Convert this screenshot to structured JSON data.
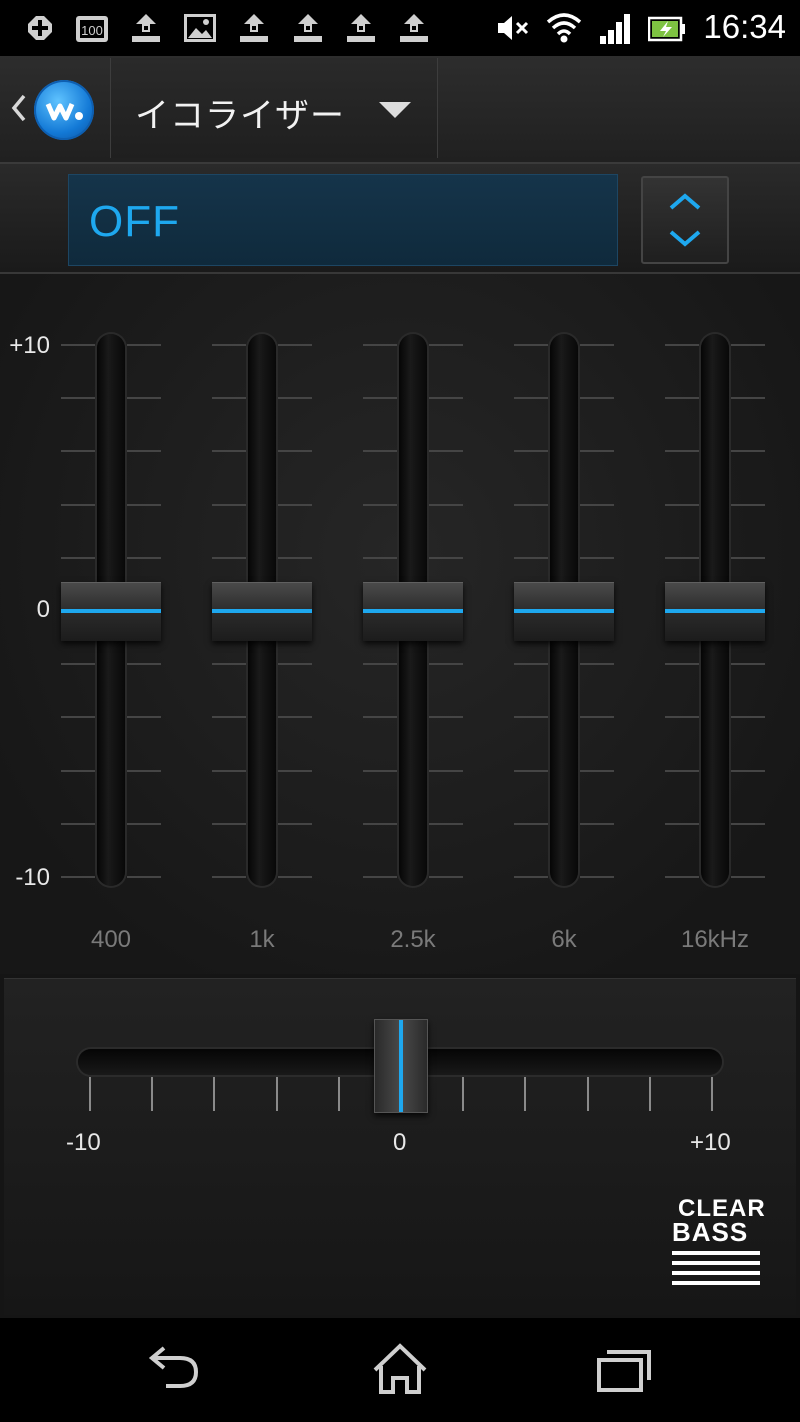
{
  "status_bar": {
    "time": "16:34",
    "left_icons": [
      "plus-badge-icon",
      "battery-100-icon",
      "upload-icon",
      "image-icon",
      "upload-icon",
      "upload-icon",
      "upload-icon",
      "upload-icon"
    ],
    "right_icons": [
      "mute-icon",
      "wifi-icon",
      "signal-icon",
      "battery-charging-icon"
    ]
  },
  "action_bar": {
    "title": "イコライザー",
    "app_icon": "walkman-icon"
  },
  "preset": {
    "value": "OFF"
  },
  "equalizer": {
    "scale": {
      "top": "+10",
      "mid": "0",
      "bottom": "-10"
    },
    "bands": [
      {
        "label": "400",
        "value": 0
      },
      {
        "label": "1k",
        "value": 0
      },
      {
        "label": "2.5k",
        "value": 0
      },
      {
        "label": "6k",
        "value": 0
      },
      {
        "label": "16kHz",
        "value": 0
      }
    ],
    "range": [
      -10,
      10
    ],
    "accent_color": "#1ea8ef"
  },
  "clear_bass": {
    "min_label": "-10",
    "mid_label": "0",
    "max_label": "+10",
    "value": 0,
    "range": [
      -10,
      10
    ],
    "logo_text_top": "CLEAR",
    "logo_text_bottom": "BASS"
  },
  "nav_bar": {
    "buttons": [
      "back-icon",
      "home-icon",
      "recent-apps-icon"
    ]
  }
}
